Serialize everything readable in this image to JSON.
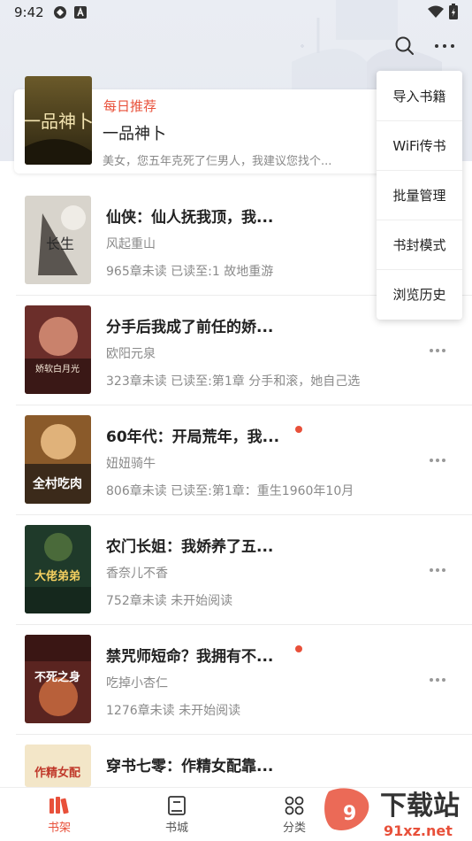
{
  "status": {
    "time": "9:42"
  },
  "header": {
    "search_icon": "search-icon",
    "more_icon": "more-icon"
  },
  "featured": {
    "tag": "每日推荐",
    "title": "一品神卜",
    "desc": "美女，您五年克死了仨男人，我建议您找个...",
    "cover_text": "一品神卜"
  },
  "books": [
    {
      "title": "仙侠：仙人抚我顶，我...",
      "author": "风起重山",
      "progress": "965章未读 已读至:1 故地重游",
      "unread_dot": false,
      "cover_text": "长生"
    },
    {
      "title": "分手后我成了前任的娇...",
      "author": "欧阳元泉",
      "progress": "323章未读 已读至:第1章 分手和滚，她自己选",
      "unread_dot": false,
      "cover_text": "娇软白月光"
    },
    {
      "title": "60年代：开局荒年，我...",
      "author": "妞妞骑牛",
      "progress": "806章未读 已读至:第1章：重生1960年10月",
      "unread_dot": true,
      "cover_text": "全村吃肉"
    },
    {
      "title": "农门长姐：我娇养了五...",
      "author": "香奈儿不香",
      "progress": "752章未读 未开始阅读",
      "unread_dot": false,
      "cover_text": "大佬弟弟"
    },
    {
      "title": "禁咒师短命？我拥有不...",
      "author": "吃掉小杏仁",
      "progress": "1276章未读 未开始阅读",
      "unread_dot": true,
      "cover_text": "不死之身"
    },
    {
      "title": "穿书七零：作精女配靠...",
      "author": "",
      "progress": "",
      "unread_dot": false,
      "cover_text": "作精女配"
    }
  ],
  "menu": {
    "items": [
      "导入书籍",
      "WiFi传书",
      "批量管理",
      "书封模式",
      "浏览历史"
    ]
  },
  "nav": {
    "items": [
      {
        "label": "书架",
        "icon": "bookshelf-icon",
        "active": true
      },
      {
        "label": "书城",
        "icon": "bookstore-icon",
        "active": false
      },
      {
        "label": "分类",
        "icon": "category-icon",
        "active": false
      }
    ]
  },
  "colors": {
    "accent": "#e8503a",
    "text": "#222222",
    "muted": "#8a8a8a"
  },
  "watermark": {
    "text1": "下载站",
    "text2": "91xz.net"
  }
}
